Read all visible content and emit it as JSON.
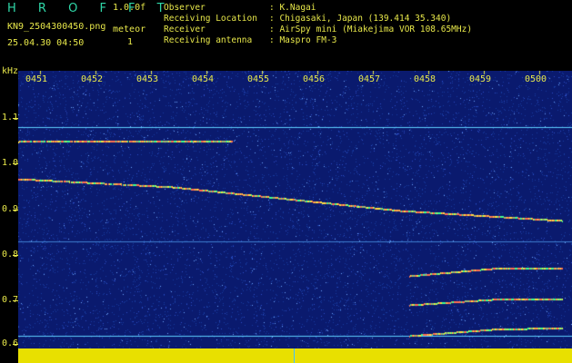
{
  "header": {
    "title": "H R O F F T",
    "version": "1.0.0f",
    "filename": "KN9_2504300450.png",
    "datetime": "25.04.30 04:50",
    "mode": "meteor",
    "count": "1"
  },
  "info": [
    {
      "label": "Observer",
      "value": ": K.Nagai"
    },
    {
      "label": "Receiving Location",
      "value": ": Chigasaki, Japan (139.414 35.340)"
    },
    {
      "label": "Receiver",
      "value": ": AirSpy mini (Miakejima VOR 108.65MHz)"
    },
    {
      "label": "Receiving antenna",
      "value": ": Maspro FM-3"
    }
  ],
  "axis": {
    "y_unit": "kHz",
    "y_ticks": [
      "1.1",
      "1.0",
      "0.9",
      "0.8",
      "0.7",
      "0.6"
    ],
    "x_ticks": [
      "0451",
      "0452",
      "0453",
      "0454",
      "0455",
      "0456",
      "0457",
      "0458",
      "0459",
      "0500"
    ]
  },
  "colors": {
    "background": "#000000",
    "text": "#e8e84a",
    "title": "#2fd8a8",
    "spectrogram": "#0a1a6e",
    "signal_bar": "#e8e000"
  }
}
